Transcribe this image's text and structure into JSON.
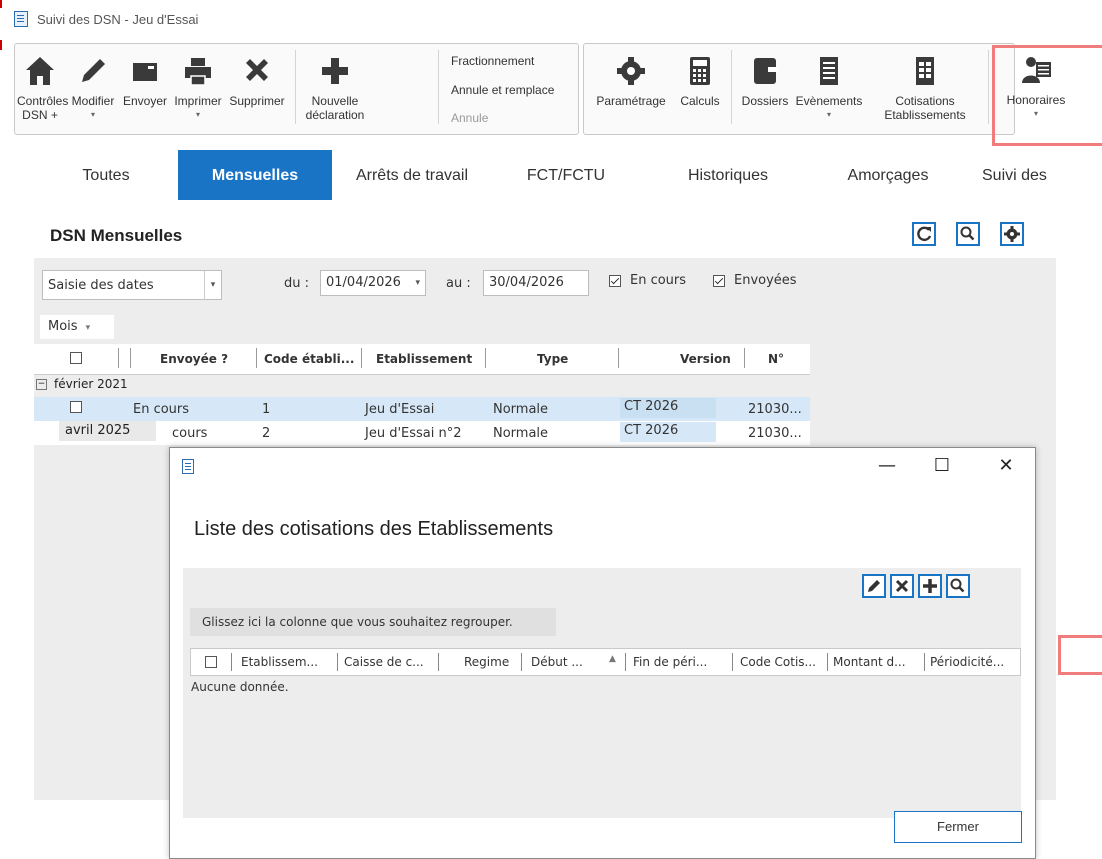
{
  "window": {
    "title": "Suivi des DSN - Jeu d'Essai"
  },
  "ribbon": {
    "controles": "Contrôles",
    "controles2": "DSN +",
    "modifier": "Modifier",
    "envoyer": "Envoyer",
    "imprimer": "Imprimer",
    "supprimer": "Supprimer",
    "nouvelle": "Nouvelle",
    "nouvelle2": "déclaration",
    "fractionnement": "Fractionnement",
    "annule_remplace": "Annule et remplace",
    "annule": "Annule",
    "parametrage": "Paramétrage",
    "calculs": "Calculs",
    "dossiers": "Dossiers",
    "evenements": "Evènements",
    "cotisations": "Cotisations",
    "cotisations2": "Etablissements",
    "honoraires": "Honoraires"
  },
  "tabs": [
    "Toutes",
    "Mensuelles",
    "Arrêts de travail",
    "FCT/FCTU",
    "Historiques",
    "Amorçages",
    "Suivi des"
  ],
  "panel": {
    "title": "DSN Mensuelles",
    "date_mode": "Saisie des dates",
    "du_label": "du :",
    "du_value": "01/04/2026",
    "au_label": "au :",
    "au_value": "30/04/2026",
    "en_cours_label": "En cours",
    "envoyees_label": "Envoyées",
    "group_by": "Mois"
  },
  "grid": {
    "columns": [
      "Envoyée ?",
      "Code établi...",
      "Etablissement",
      "Type",
      "Version",
      "N°"
    ],
    "group_label": "février 2021",
    "rows": [
      {
        "envoyee": "En cours",
        "code": "1",
        "etab": "Jeu d'Essai",
        "type": "Normale",
        "version": "CT 2026",
        "num": "21030..."
      },
      {
        "envoyee": "cours",
        "code": "2",
        "etab": "Jeu d'Essai n°2",
        "type": "Normale",
        "version": "CT 2026",
        "num": "21030..."
      }
    ],
    "overlay_text": "avril 2025"
  },
  "dialog": {
    "title": "Liste des cotisations des Etablissements",
    "group_hint": "Glissez ici la colonne que vous souhaitez regrouper.",
    "columns": [
      "Etablissem...",
      "Caisse de c...",
      "Regime",
      "Début ...",
      "Fin de péri...",
      "Code Cotis...",
      "Montant d...",
      "Périodicité..."
    ],
    "no_data": "Aucune donnée.",
    "close_label": "Fermer"
  }
}
